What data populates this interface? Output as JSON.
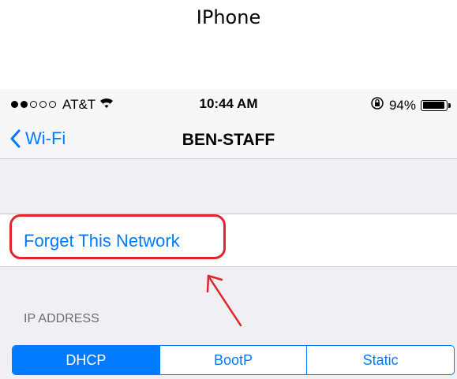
{
  "caption": "IPhone",
  "status_bar": {
    "signal_filled": 2,
    "signal_total": 5,
    "carrier": "AT&T",
    "wifi_icon": "wifi-icon",
    "time": "10:44 AM",
    "rotation_lock_icon": "rotation-lock-icon",
    "battery_percent": "94%",
    "battery_level": 0.94
  },
  "nav": {
    "back_label": "Wi-Fi",
    "title": "BEN-STAFF"
  },
  "forget_button_label": "Forget This Network",
  "ip_section_header": "IP ADDRESS",
  "segmented": {
    "options": [
      "DHCP",
      "BootP",
      "Static"
    ],
    "selected": "DHCP"
  },
  "colors": {
    "accent": "#007aff",
    "annotation": "#e0262a",
    "grouped_background": "#efeff4"
  }
}
